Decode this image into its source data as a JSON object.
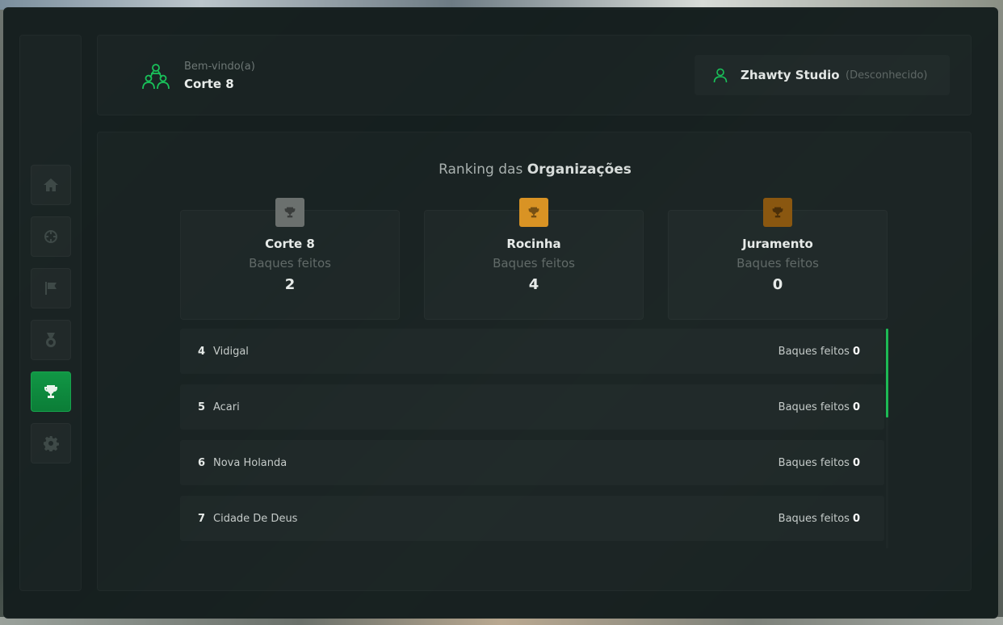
{
  "header": {
    "welcome": "Bem-vindo(a)",
    "org_name": "Corte 8",
    "user_name": "Zhawty Studio",
    "user_status": "(Desconhecido)"
  },
  "sidebar": {
    "items": [
      {
        "icon": "home-icon",
        "active": false
      },
      {
        "icon": "crosshair-icon",
        "active": false
      },
      {
        "icon": "flag-icon",
        "active": false
      },
      {
        "icon": "medal-icon",
        "active": false
      },
      {
        "icon": "trophy-icon",
        "active": true
      },
      {
        "icon": "gear-icon",
        "active": false
      }
    ]
  },
  "title": {
    "prefix": "Ranking das",
    "bold": "Organizações"
  },
  "podium": [
    {
      "name": "Corte 8",
      "label": "Baques feitos",
      "value": "2",
      "color": "#6b706e"
    },
    {
      "name": "Rocinha",
      "label": "Baques feitos",
      "value": "4",
      "color": "#d99324"
    },
    {
      "name": "Juramento",
      "label": "Baques feitos",
      "value": "0",
      "color": "#8a5710"
    }
  ],
  "ranking": [
    {
      "position": "4",
      "name": "Vidigal",
      "label": "Baques feitos",
      "value": "0"
    },
    {
      "position": "5",
      "name": "Acari",
      "label": "Baques feitos",
      "value": "0"
    },
    {
      "position": "6",
      "name": "Nova Holanda",
      "label": "Baques feitos",
      "value": "0"
    },
    {
      "position": "7",
      "name": "Cidade De Deus",
      "label": "Baques feitos",
      "value": "0"
    }
  ],
  "colors": {
    "accent": "#17a34d"
  }
}
